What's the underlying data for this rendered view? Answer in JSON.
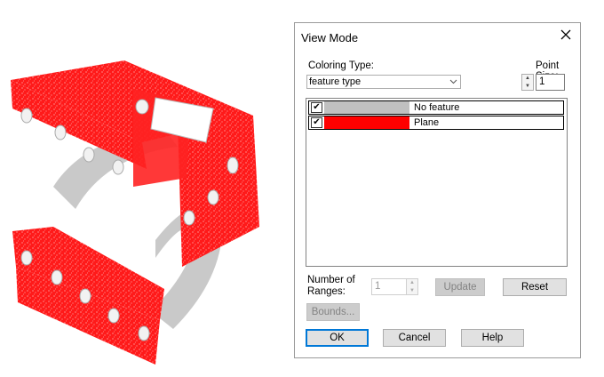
{
  "dialog": {
    "title": "View Mode",
    "coloring_type_label": "Coloring Type:",
    "coloring_type_value": "feature type",
    "point_size_label": "Point Size:",
    "point_size_value": "1",
    "features": [
      {
        "checked": "✔",
        "color": "#c0c0c0",
        "label": "No feature"
      },
      {
        "checked": "✔",
        "color": "#ff0000",
        "label": "Plane"
      }
    ],
    "ranges_label_1": "Number of",
    "ranges_label_2": "Ranges:",
    "ranges_value": "1",
    "update_label": "Update",
    "reset_label": "Reset",
    "bounds_label": "Bounds...",
    "ok_label": "OK",
    "cancel_label": "Cancel",
    "help_label": "Help"
  },
  "colors": {
    "feature_red": "#ff0000",
    "no_feature_gray": "#c8c8c8",
    "accent": "#0078d7"
  }
}
